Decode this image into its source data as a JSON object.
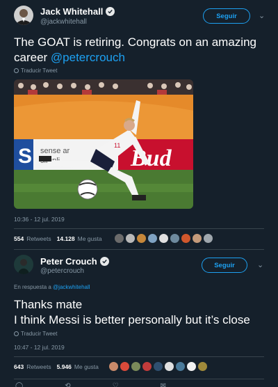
{
  "tweet1": {
    "name": "Jack Whitehall",
    "handle": "@jackwhitehall",
    "follow_label": "Seguir",
    "text_main": "The GOAT is retiring. Congrats on an amazing career ",
    "text_mention": "@petercrouch",
    "translate_label": "Traducir Tweet",
    "image_alt": "Peter Crouch volleying a football",
    "timestamp": "10:36 - 12 jul. 2019",
    "retweets_count": "554",
    "retweets_label": "Retweets",
    "likes_count": "14.128",
    "likes_label": "Me gusta"
  },
  "tweet2": {
    "name": "Peter Crouch",
    "handle": "@petercrouch",
    "follow_label": "Seguir",
    "reply_prefix": "En respuesta a ",
    "reply_mention": "@jackwhitehall",
    "text_line1": "Thanks mate",
    "text_line2": "I think Messi is better personally but it’s close",
    "translate_label": "Traducir Tweet",
    "timestamp": "10:47 - 12 jul. 2019",
    "retweets_count": "643",
    "retweets_label": "Retweets",
    "likes_count": "5.946",
    "likes_label": "Me gusta"
  },
  "icons": {
    "verified": "verified-badge-icon",
    "chevron": "chevron-down-icon",
    "globe": "globe-icon"
  },
  "colors": {
    "background": "#15202b",
    "accent": "#1da1f2",
    "muted": "#8899a6",
    "divider": "#38444d"
  }
}
